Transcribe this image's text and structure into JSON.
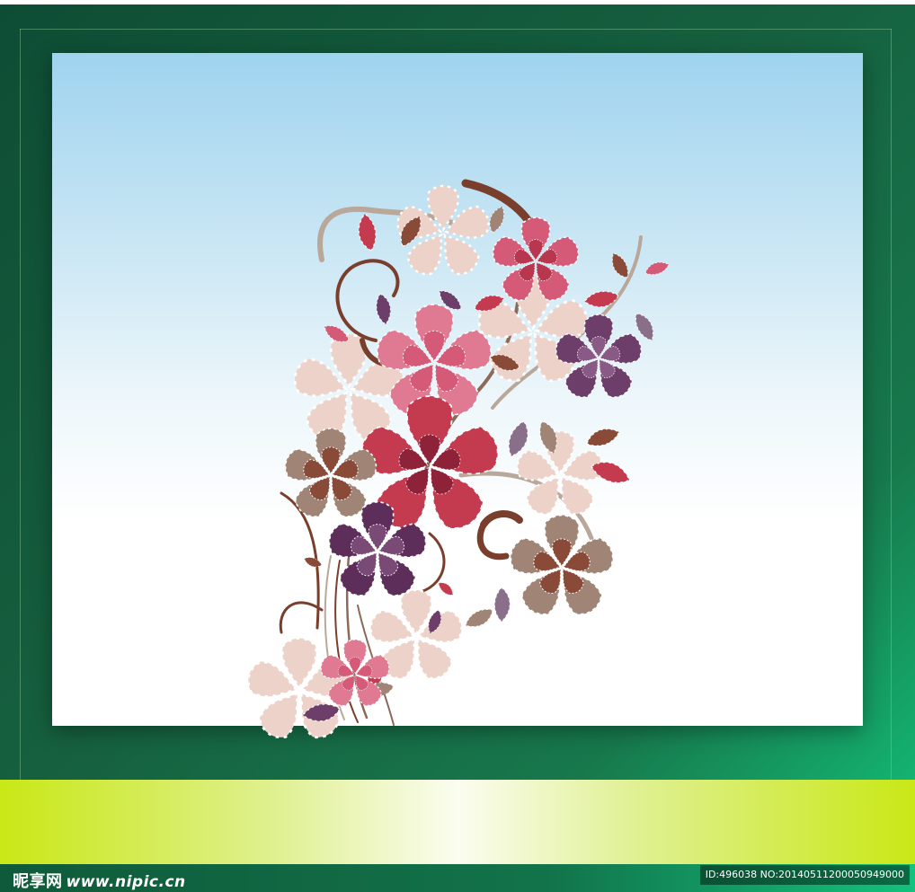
{
  "watermark": {
    "brand": "昵享网",
    "url": "www.nipic.cn",
    "image_id": "ID:496038 NO:20140511200050949000"
  },
  "colors": {
    "frame_green": "#16603f",
    "frame_green_light": "#13c77e",
    "sky_top": "#9fd3ef",
    "band_lime": "#c9e816",
    "flower_red": "#c43a4e",
    "flower_pink": "#d45a78",
    "flower_purple": "#6e3e6a",
    "flower_tan": "#a08476",
    "flower_blush": "#ecd2c8",
    "stem_brown": "#7a3f2c"
  },
  "artwork": {
    "subject": "floral-swirl-illustration"
  }
}
